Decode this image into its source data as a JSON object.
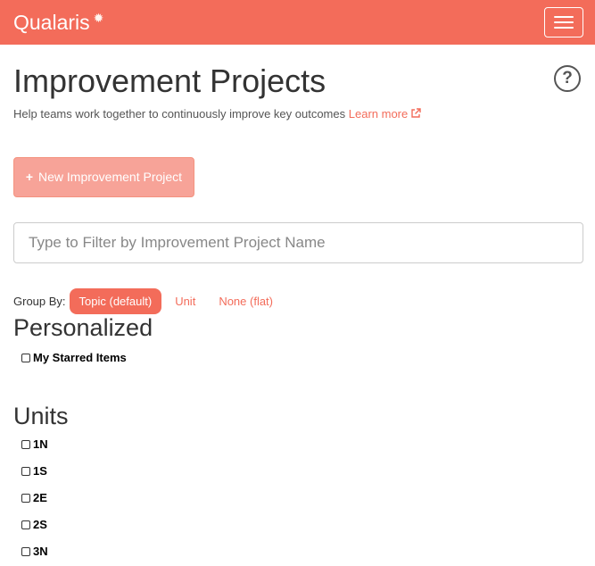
{
  "navbar": {
    "brand": "Qualaris",
    "brand_mark": "✹",
    "menu_icon": "hamburger-icon"
  },
  "header": {
    "title": "Improvement Projects",
    "subtitle": "Help teams work together to continuously improve key outcomes",
    "learn_more": "Learn more",
    "help_icon": "?"
  },
  "actions": {
    "new_project_plus": "+",
    "new_project_label": "New Improvement Project"
  },
  "filter": {
    "placeholder": "Type to Filter by Improvement Project Name",
    "value": ""
  },
  "group_by": {
    "label": "Group By:",
    "options": [
      "Topic (default)",
      "Unit",
      "None (flat)"
    ],
    "selected": "Topic (default)"
  },
  "sections": [
    {
      "title": "Personalized",
      "items": [
        "My Starred Items"
      ]
    },
    {
      "title": "Units",
      "items": [
        "1N",
        "1S",
        "2E",
        "2S",
        "3N"
      ]
    }
  ],
  "colors": {
    "accent": "#f36c5a",
    "button_disabled": "#f7a398"
  }
}
